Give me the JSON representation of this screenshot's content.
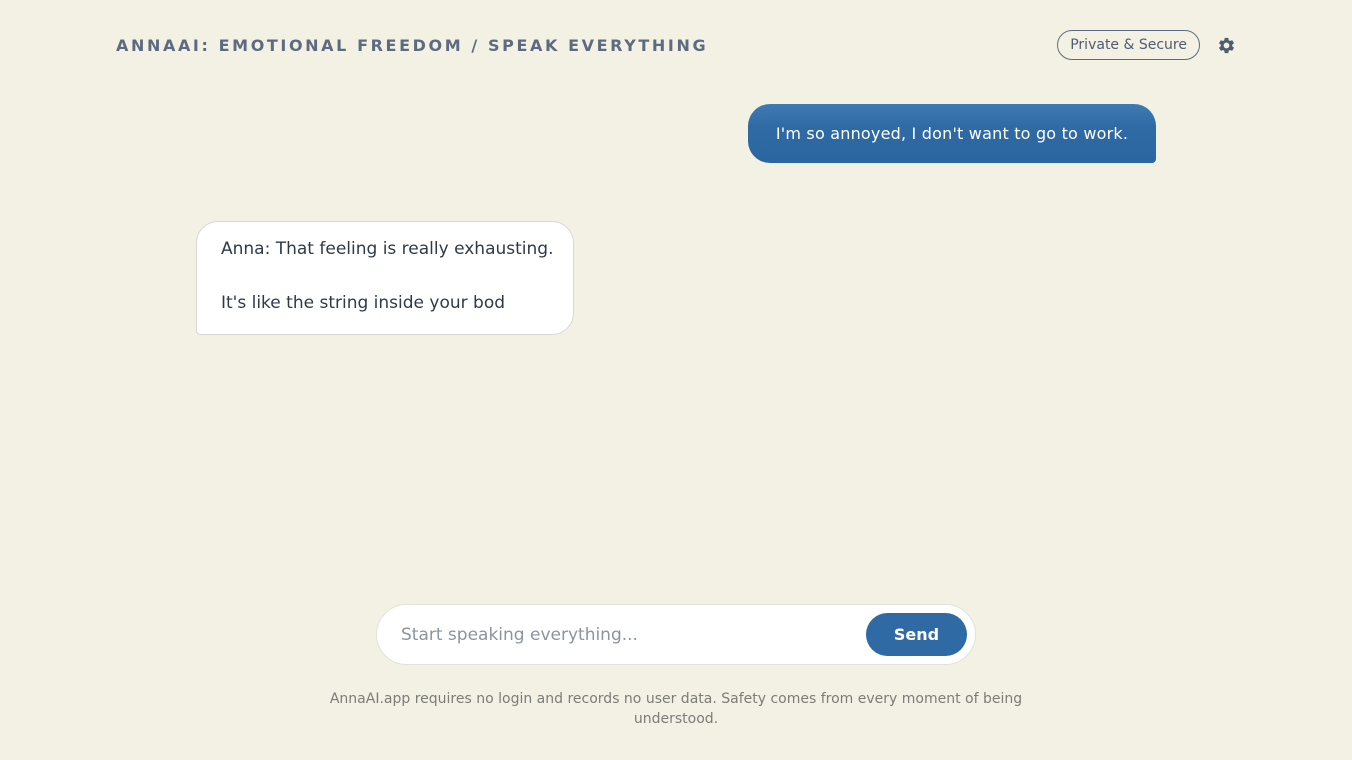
{
  "header": {
    "title": "ANNAAI: EMOTIONAL FREEDOM / SPEAK EVERYTHING",
    "privacy_badge": "Private & Secure",
    "settings_icon": "gear-icon"
  },
  "conversation": {
    "user_message": "I'm so annoyed, I don't want to go to work.",
    "ai_message": {
      "line1": "Anna: That feeling is really exhausting.",
      "line2": "It's like the string inside your bod"
    }
  },
  "composer": {
    "placeholder": "Start speaking everything...",
    "value": "",
    "send_label": "Send"
  },
  "footer": {
    "note": "AnnaAI.app requires no login and records no user data. Safety comes from every moment of being understood."
  },
  "colors": {
    "background": "#f3f1e4",
    "accent": "#2f6aa4",
    "title": "#5d6b82"
  }
}
